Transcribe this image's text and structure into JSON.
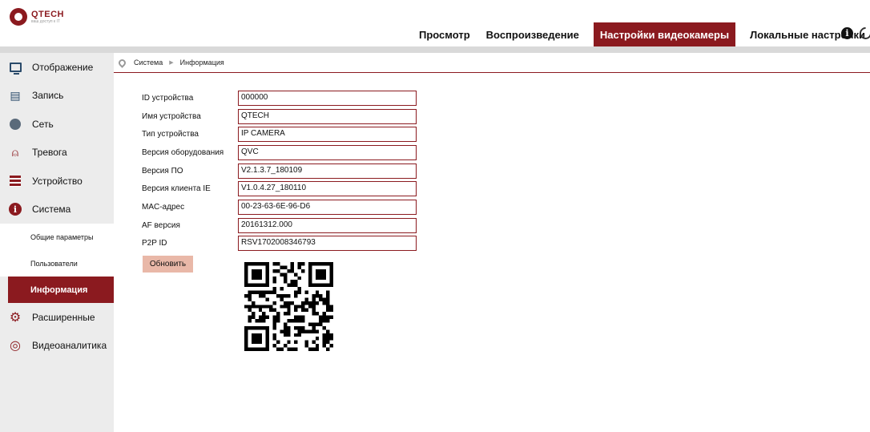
{
  "brand": {
    "name": "QTECH",
    "tagline": "ваш доступ к IT"
  },
  "nav": {
    "items": [
      {
        "label": "Просмотр",
        "active": false
      },
      {
        "label": "Воспроизведение",
        "active": false
      },
      {
        "label": "Настройки видеокамеры",
        "active": true
      },
      {
        "label": "Локальные настройки",
        "active": false
      }
    ],
    "icons": [
      "info-icon",
      "power-icon"
    ]
  },
  "sidebar": {
    "items": [
      {
        "label": "Отображение",
        "icon": "display-icon"
      },
      {
        "label": "Запись",
        "icon": "record-icon"
      },
      {
        "label": "Сеть",
        "icon": "network-icon"
      },
      {
        "label": "Тревога",
        "icon": "alarm-icon"
      },
      {
        "label": "Устройство",
        "icon": "device-icon"
      },
      {
        "label": "Система",
        "icon": "system-icon"
      }
    ],
    "subitems": [
      {
        "label": "Общие параметры",
        "active": false
      },
      {
        "label": "Пользователи",
        "active": false
      },
      {
        "label": "Информация",
        "active": true
      }
    ],
    "items_after": [
      {
        "label": "Расширенные",
        "icon": "advanced-icon"
      },
      {
        "label": "Видеоаналитика",
        "icon": "analytics-icon"
      }
    ]
  },
  "breadcrumb": {
    "root": "Система",
    "current": "Информация"
  },
  "form": {
    "fields": [
      {
        "label": "ID устройства",
        "value": "000000"
      },
      {
        "label": "Имя устройства",
        "value": "QTECH"
      },
      {
        "label": "Тип устройства",
        "value": "IP CAMERA"
      },
      {
        "label": "Версия оборудования",
        "value": "QVC"
      },
      {
        "label": "Версия ПО",
        "value": "V2.1.3.7_180109"
      },
      {
        "label": "Версия клиента IE",
        "value": "V1.0.4.27_180110"
      },
      {
        "label": "MAC-адрес",
        "value": "00-23-63-6E-96-D6"
      },
      {
        "label": "AF версия",
        "value": "20161312.000"
      },
      {
        "label": "P2P ID",
        "value": "RSV1702008346793"
      }
    ],
    "refresh_label": "Обновить"
  },
  "colors": {
    "accent": "#8b1a1f",
    "button": "#e9b8a8",
    "sidebar_bg": "#ececec"
  }
}
